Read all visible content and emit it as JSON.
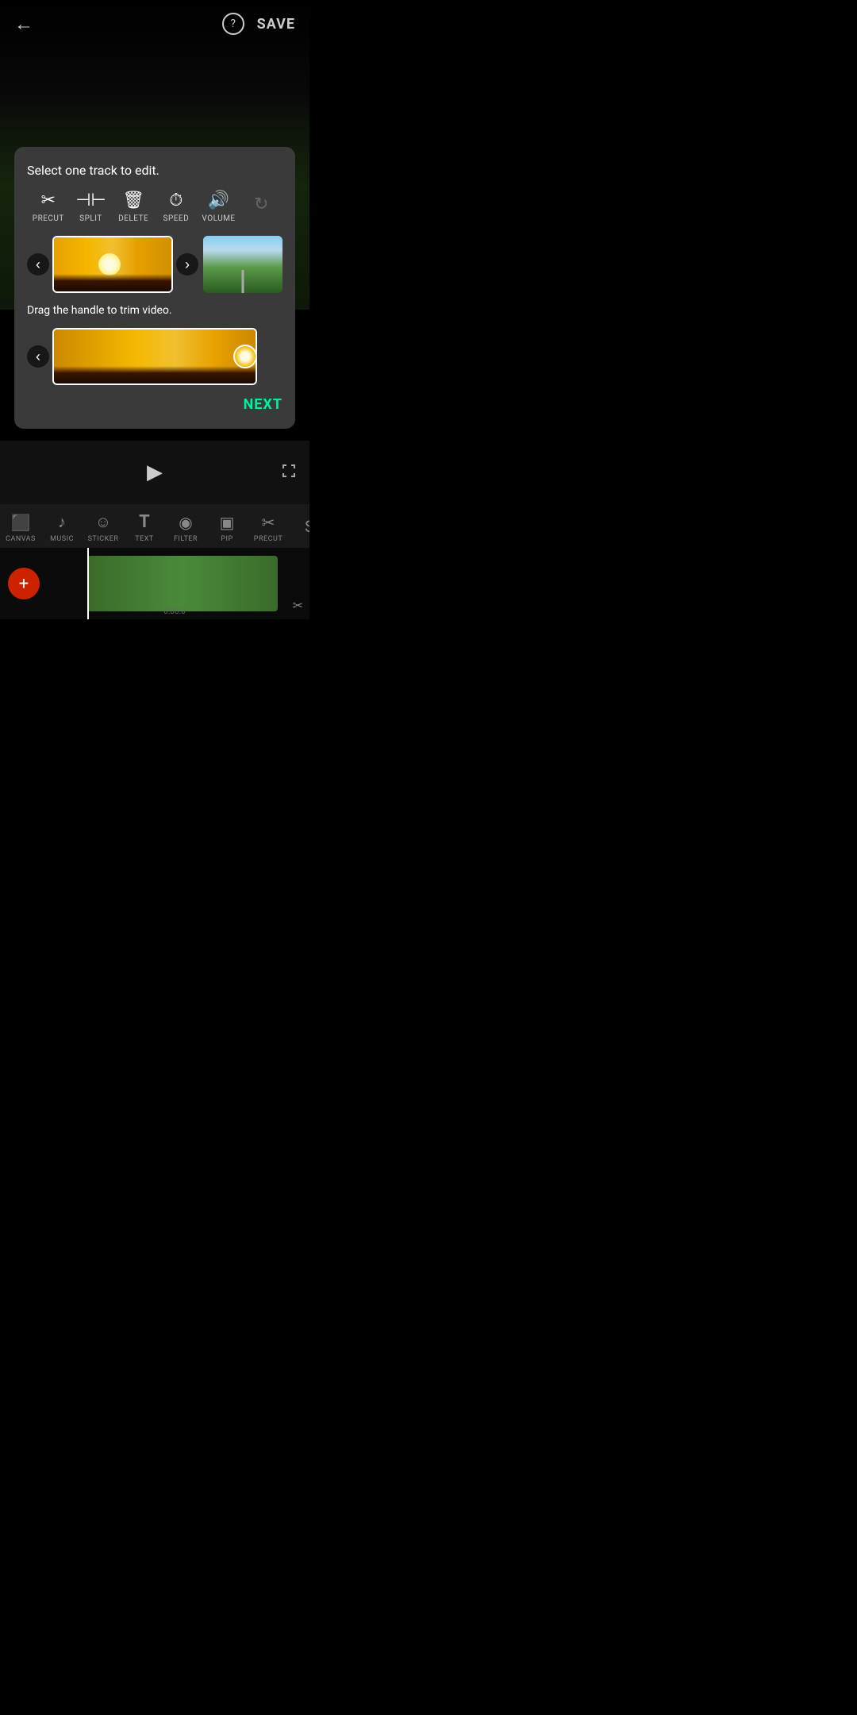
{
  "header": {
    "back_label": "←",
    "help_label": "?",
    "save_label": "SAVE"
  },
  "modal": {
    "title": "Select one track to edit.",
    "tools": [
      {
        "id": "precut",
        "icon": "✂",
        "label": "PRECUT",
        "disabled": false
      },
      {
        "id": "split",
        "icon": "⊣⊢",
        "label": "SPLIT",
        "disabled": false
      },
      {
        "id": "delete",
        "icon": "🗑",
        "label": "DELETE",
        "disabled": false
      },
      {
        "id": "speed",
        "icon": "⏱",
        "label": "SPEED",
        "disabled": false
      },
      {
        "id": "volume",
        "icon": "🔊",
        "label": "VOLUME",
        "disabled": false
      },
      {
        "id": "rotate",
        "icon": "↻",
        "label": "",
        "disabled": true
      }
    ],
    "hint": "Drag the handle to trim video.",
    "next_label": "NEXT"
  },
  "bottom_toolbar": {
    "items": [
      {
        "id": "canvas",
        "icon": "⬜",
        "label": "CANVAS"
      },
      {
        "id": "music",
        "icon": "♪",
        "label": "MUSIC"
      },
      {
        "id": "sticker",
        "icon": "☺",
        "label": "STICKER"
      },
      {
        "id": "text",
        "icon": "T",
        "label": "TEXT"
      },
      {
        "id": "filter",
        "icon": "◉",
        "label": "FILTER"
      },
      {
        "id": "pip",
        "icon": "▣",
        "label": "PIP"
      },
      {
        "id": "precut",
        "icon": "✂",
        "label": "PRECUT"
      },
      {
        "id": "s",
        "icon": "S",
        "label": "S"
      }
    ]
  },
  "timeline": {
    "time_label": "0:00.0",
    "add_icon": "+"
  }
}
